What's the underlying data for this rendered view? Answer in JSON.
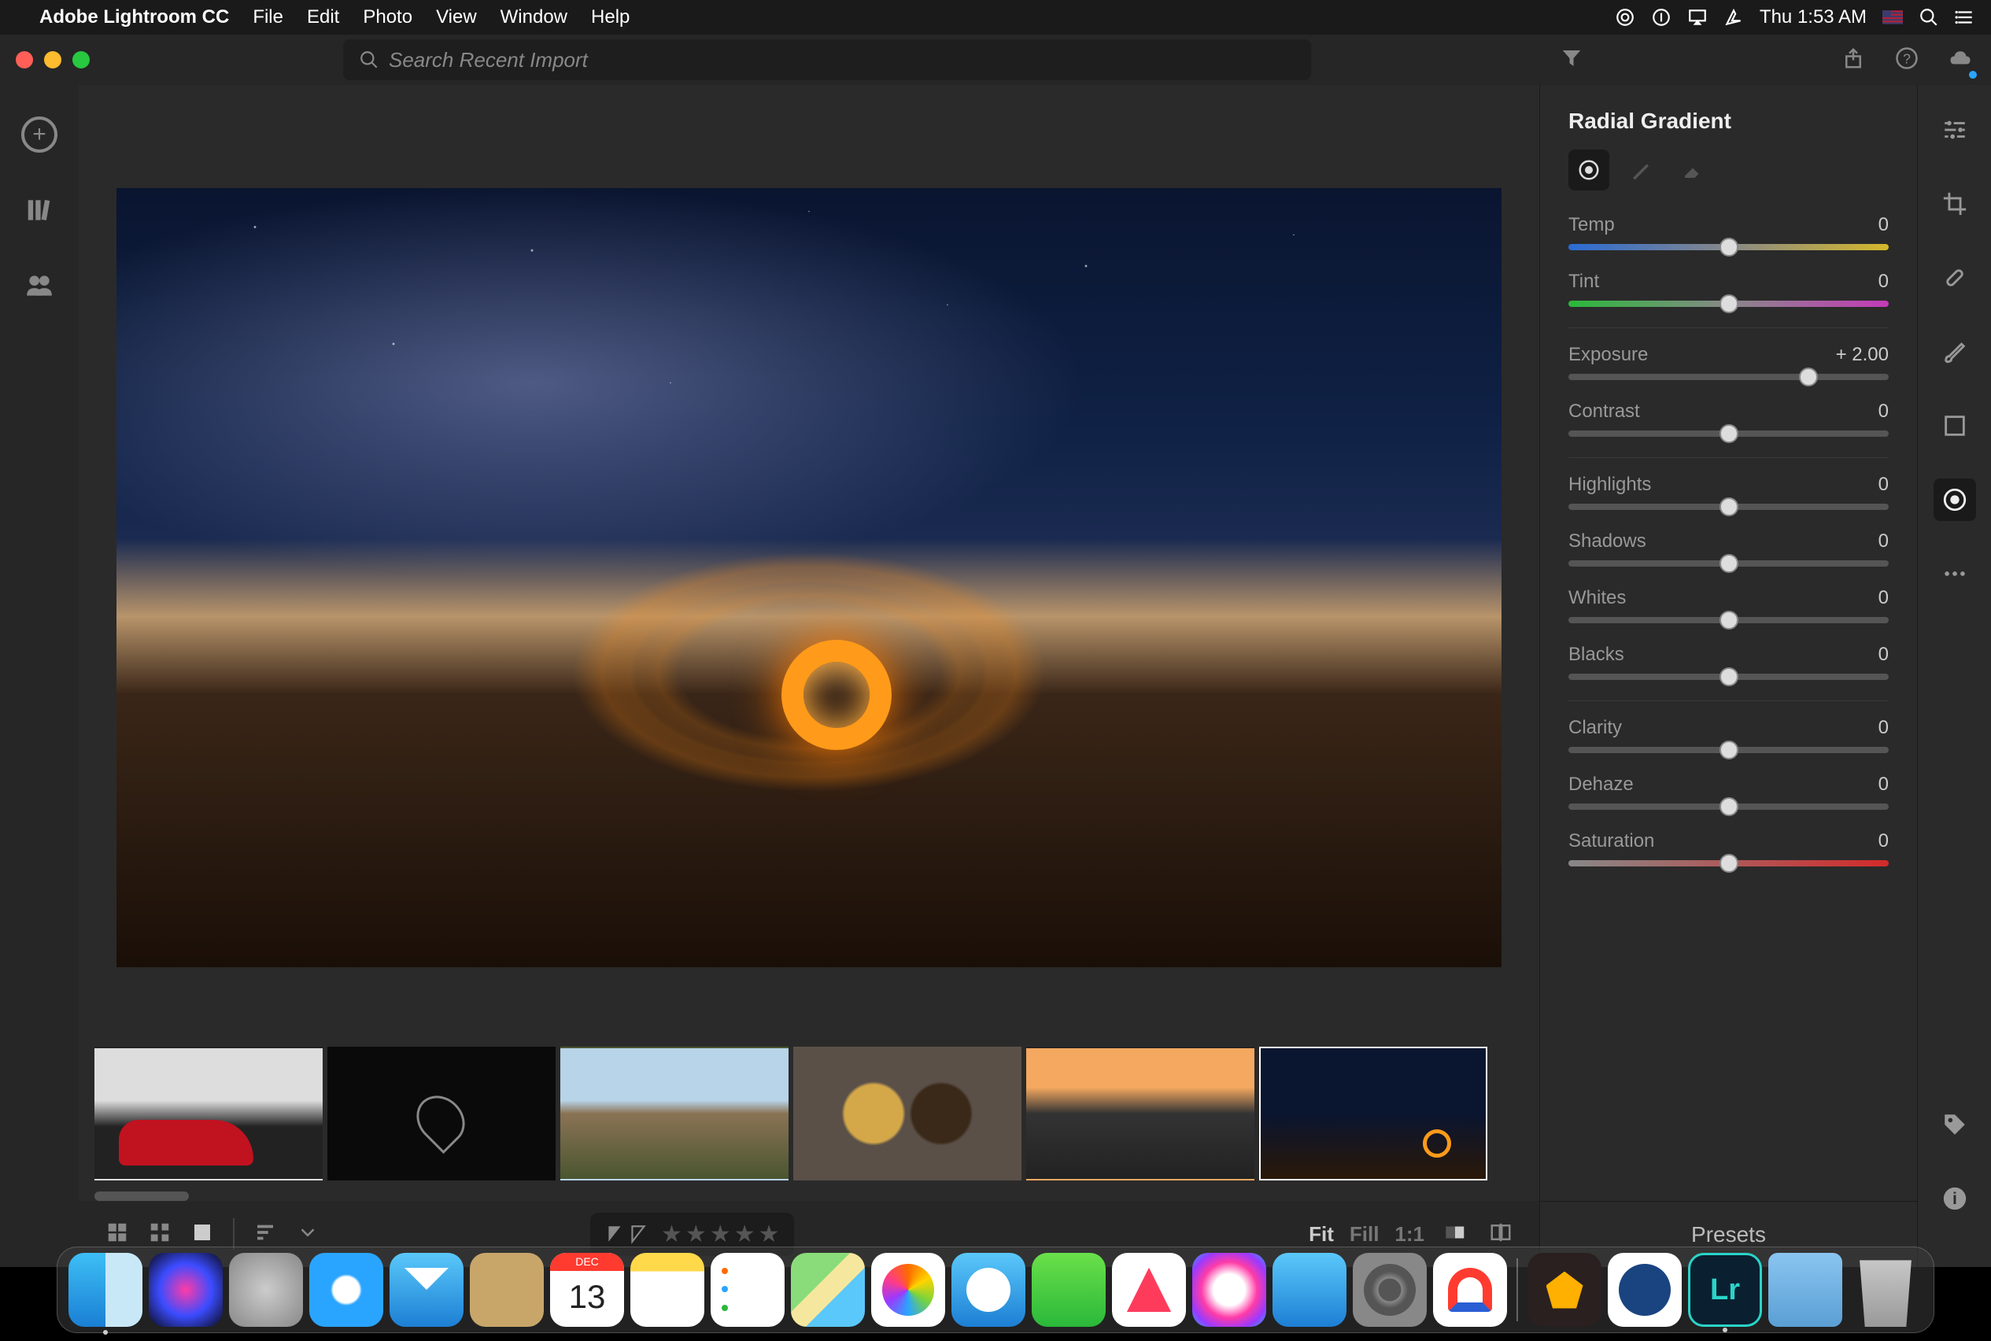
{
  "menubar": {
    "apple": "",
    "appname": "Adobe Lightroom CC",
    "items": [
      "File",
      "Edit",
      "Photo",
      "View",
      "Window",
      "Help"
    ],
    "clock": "Thu 1:53 AM"
  },
  "titlebar": {
    "search_placeholder": "Search Recent Import"
  },
  "leftbar": {
    "items": [
      "add",
      "library",
      "shared"
    ]
  },
  "rightpanel": {
    "title": "Radial Gradient",
    "tools": [
      "mask-new",
      "brush",
      "eraser"
    ],
    "sliders": [
      {
        "key": "temp",
        "label": "Temp",
        "value": "0",
        "pos": 50,
        "track": "temp"
      },
      {
        "key": "tint",
        "label": "Tint",
        "value": "0",
        "pos": 50,
        "track": "tint"
      },
      {
        "key": "exposure",
        "label": "Exposure",
        "value": "+ 2.00",
        "pos": 75,
        "track": "plain",
        "gap_before": true
      },
      {
        "key": "contrast",
        "label": "Contrast",
        "value": "0",
        "pos": 50,
        "track": "plain"
      },
      {
        "key": "highlights",
        "label": "Highlights",
        "value": "0",
        "pos": 50,
        "track": "plain",
        "gap_before": true
      },
      {
        "key": "shadows",
        "label": "Shadows",
        "value": "0",
        "pos": 50,
        "track": "plain"
      },
      {
        "key": "whites",
        "label": "Whites",
        "value": "0",
        "pos": 50,
        "track": "plain"
      },
      {
        "key": "blacks",
        "label": "Blacks",
        "value": "0",
        "pos": 50,
        "track": "plain"
      },
      {
        "key": "clarity",
        "label": "Clarity",
        "value": "0",
        "pos": 50,
        "track": "plain",
        "gap_before": true
      },
      {
        "key": "dehaze",
        "label": "Dehaze",
        "value": "0",
        "pos": 50,
        "track": "plain"
      },
      {
        "key": "saturation",
        "label": "Saturation",
        "value": "0",
        "pos": 50,
        "track": "sat"
      }
    ],
    "presets_label": "Presets"
  },
  "toolstrip": {
    "tools": [
      "adjust",
      "crop",
      "heal",
      "brush",
      "linear",
      "radial",
      "more"
    ],
    "active": "radial",
    "bottom": [
      "tag",
      "info"
    ]
  },
  "bottombar": {
    "zoom": {
      "fit": "Fit",
      "fill": "Fill",
      "one": "1:1"
    }
  },
  "filmstrip": {
    "thumbs": [
      "car",
      "logo",
      "mountains",
      "coffee",
      "seascape",
      "sparks"
    ],
    "selected": 5
  },
  "dock": {
    "left": [
      "finder",
      "siri",
      "launchpad",
      "safari",
      "mail",
      "contacts",
      "calendar",
      "notes",
      "reminders",
      "maps",
      "photos",
      "messages",
      "facetime",
      "news",
      "itunes",
      "appstore",
      "preferences",
      "magnet"
    ],
    "calendar_day": "13",
    "calendar_month": "DEC",
    "right": [
      "imovie",
      "1password",
      "lightroom",
      "downloads",
      "trash"
    ],
    "running": [
      "finder",
      "lightroom"
    ]
  }
}
